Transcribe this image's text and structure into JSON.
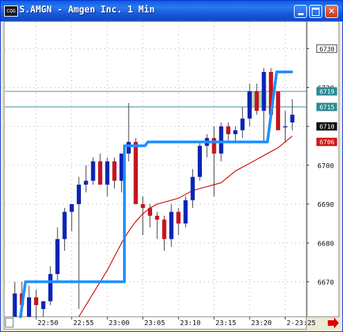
{
  "window": {
    "icon_text": "CQG",
    "title": "S.AMGN - Amgen Inc. 1 Min",
    "colors": {
      "titlebar": "#1553d6",
      "plot_background": "#ffffff",
      "grid": "#9aa7a0"
    }
  },
  "chart_data": {
    "type": "candlestick",
    "x_tick_labels": [
      "22:50",
      "22:55",
      "23:00",
      "23:05",
      "23:10",
      "23:15",
      "23:20",
      "2-23:25"
    ],
    "y_tick_labels": [
      6670,
      6680,
      6690,
      6700,
      6710,
      6720,
      6730
    ],
    "ylim": [
      6661,
      6737
    ],
    "price_tags": [
      {
        "label": "6730",
        "value": 6730,
        "style": "axis"
      },
      {
        "label": "6719",
        "value": 6719,
        "style": "teal"
      },
      {
        "label": "6715",
        "value": 6715,
        "style": "teal"
      },
      {
        "label": "6710",
        "value": 6710,
        "style": "dark"
      },
      {
        "label": "6706",
        "value": 6706,
        "style": "red"
      }
    ],
    "horizontal_lines": [
      6719,
      6715
    ],
    "candles": [
      {
        "o": 6661,
        "h": 6670,
        "l": 6661,
        "c": 6667
      },
      {
        "o": 6667,
        "h": 6670,
        "l": 6661,
        "c": 6664
      },
      {
        "o": 6661,
        "h": 6669,
        "l": 6661,
        "c": 6666
      },
      {
        "o": 6666,
        "h": 6668,
        "l": 6661,
        "c": 6664
      },
      {
        "o": 6663,
        "h": 6665,
        "l": 6661,
        "c": 6665
      },
      {
        "o": 6665,
        "h": 6674,
        "l": 6664,
        "c": 6672
      },
      {
        "o": 6672,
        "h": 6684,
        "l": 6670,
        "c": 6681
      },
      {
        "o": 6681,
        "h": 6689,
        "l": 6678,
        "c": 6688
      },
      {
        "o": 6688,
        "h": 6690,
        "l": 6683,
        "c": 6690
      },
      {
        "o": 6690,
        "h": 6697,
        "l": 6663,
        "c": 6695
      },
      {
        "o": 6695,
        "h": 6700,
        "l": 6693,
        "c": 6696
      },
      {
        "o": 6696,
        "h": 6702,
        "l": 6695,
        "c": 6701
      },
      {
        "o": 6701,
        "h": 6703,
        "l": 6695,
        "c": 6695
      },
      {
        "o": 6695,
        "h": 6702,
        "l": 6692,
        "c": 6701
      },
      {
        "o": 6701,
        "h": 6702,
        "l": 6694,
        "c": 6696
      },
      {
        "o": 6696,
        "h": 6703,
        "l": 6693,
        "c": 6703
      },
      {
        "o": 6703,
        "h": 6716,
        "l": 6701,
        "c": 6706
      },
      {
        "o": 6706,
        "h": 6707,
        "l": 6690,
        "c": 6690
      },
      {
        "o": 6690,
        "h": 6692,
        "l": 6682,
        "c": 6689
      },
      {
        "o": 6689,
        "h": 6690,
        "l": 6684,
        "c": 6687
      },
      {
        "o": 6687,
        "h": 6688,
        "l": 6681,
        "c": 6686
      },
      {
        "o": 6686,
        "h": 6687,
        "l": 6678,
        "c": 6681
      },
      {
        "o": 6681,
        "h": 6690,
        "l": 6679,
        "c": 6688
      },
      {
        "o": 6688,
        "h": 6689,
        "l": 6682,
        "c": 6685
      },
      {
        "o": 6685,
        "h": 6692,
        "l": 6684,
        "c": 6691
      },
      {
        "o": 6691,
        "h": 6699,
        "l": 6689,
        "c": 6697
      },
      {
        "o": 6697,
        "h": 6706,
        "l": 6696,
        "c": 6705
      },
      {
        "o": 6705,
        "h": 6708,
        "l": 6702,
        "c": 6707
      },
      {
        "o": 6707,
        "h": 6710,
        "l": 6692,
        "c": 6703
      },
      {
        "o": 6703,
        "h": 6711,
        "l": 6701,
        "c": 6710
      },
      {
        "o": 6710,
        "h": 6711,
        "l": 6706,
        "c": 6708
      },
      {
        "o": 6708,
        "h": 6710,
        "l": 6706,
        "c": 6709
      },
      {
        "o": 6709,
        "h": 6715,
        "l": 6707,
        "c": 6712
      },
      {
        "o": 6712,
        "h": 6721,
        "l": 6710,
        "c": 6719
      },
      {
        "o": 6719,
        "h": 6721,
        "l": 6713,
        "c": 6714
      },
      {
        "o": 6714,
        "h": 6725,
        "l": 6706,
        "c": 6724
      },
      {
        "o": 6724,
        "h": 6725,
        "l": 6713,
        "c": 6713
      },
      {
        "o": 6719,
        "h": 6719,
        "l": 6709,
        "c": 6709
      },
      {
        "o": 6710,
        "h": 6714,
        "l": 6706,
        "c": 6710
      },
      {
        "o": 6711,
        "h": 6717,
        "l": 6709,
        "c": 6713
      }
    ],
    "series": [
      {
        "kind": "step_line",
        "color": "#1e90ff",
        "x_index": [
          0.8,
          1.5,
          1.5,
          15.4,
          15.4,
          16.7,
          16.7,
          18.3,
          18.7,
          33.2,
          33.2,
          35.5,
          36.8,
          38.9
        ],
        "values": [
          6661,
          6670,
          6670,
          6670,
          6705,
          6705,
          6705,
          6705,
          6706,
          6706,
          6706,
          6706,
          6724,
          6724
        ]
      },
      {
        "kind": "moving_average",
        "color": "#cc0000",
        "x_index": [
          9,
          10,
          11,
          12,
          13,
          14,
          15,
          16,
          17,
          18,
          19,
          20,
          21,
          22,
          23,
          24,
          25,
          26,
          27,
          28,
          29,
          30,
          31,
          32,
          33,
          34,
          35,
          36,
          37,
          38,
          39
        ],
        "values": [
          6661,
          6664,
          6667,
          6670,
          6673,
          6676.5,
          6680,
          6683,
          6685.5,
          6687.5,
          6689,
          6690,
          6690.5,
          6691,
          6691.5,
          6692.5,
          6693.5,
          6694,
          6694.5,
          6695,
          6695.5,
          6697,
          6698.5,
          6699.5,
          6700.5,
          6701.5,
          6702.5,
          6703.5,
          6704.5,
          6706,
          6707.5
        ]
      }
    ],
    "shaded_region": {
      "x_index_start": 33,
      "x_index_end": 35,
      "y_start": 6715,
      "y_end": 6719,
      "color": "#8fd0a8"
    }
  }
}
